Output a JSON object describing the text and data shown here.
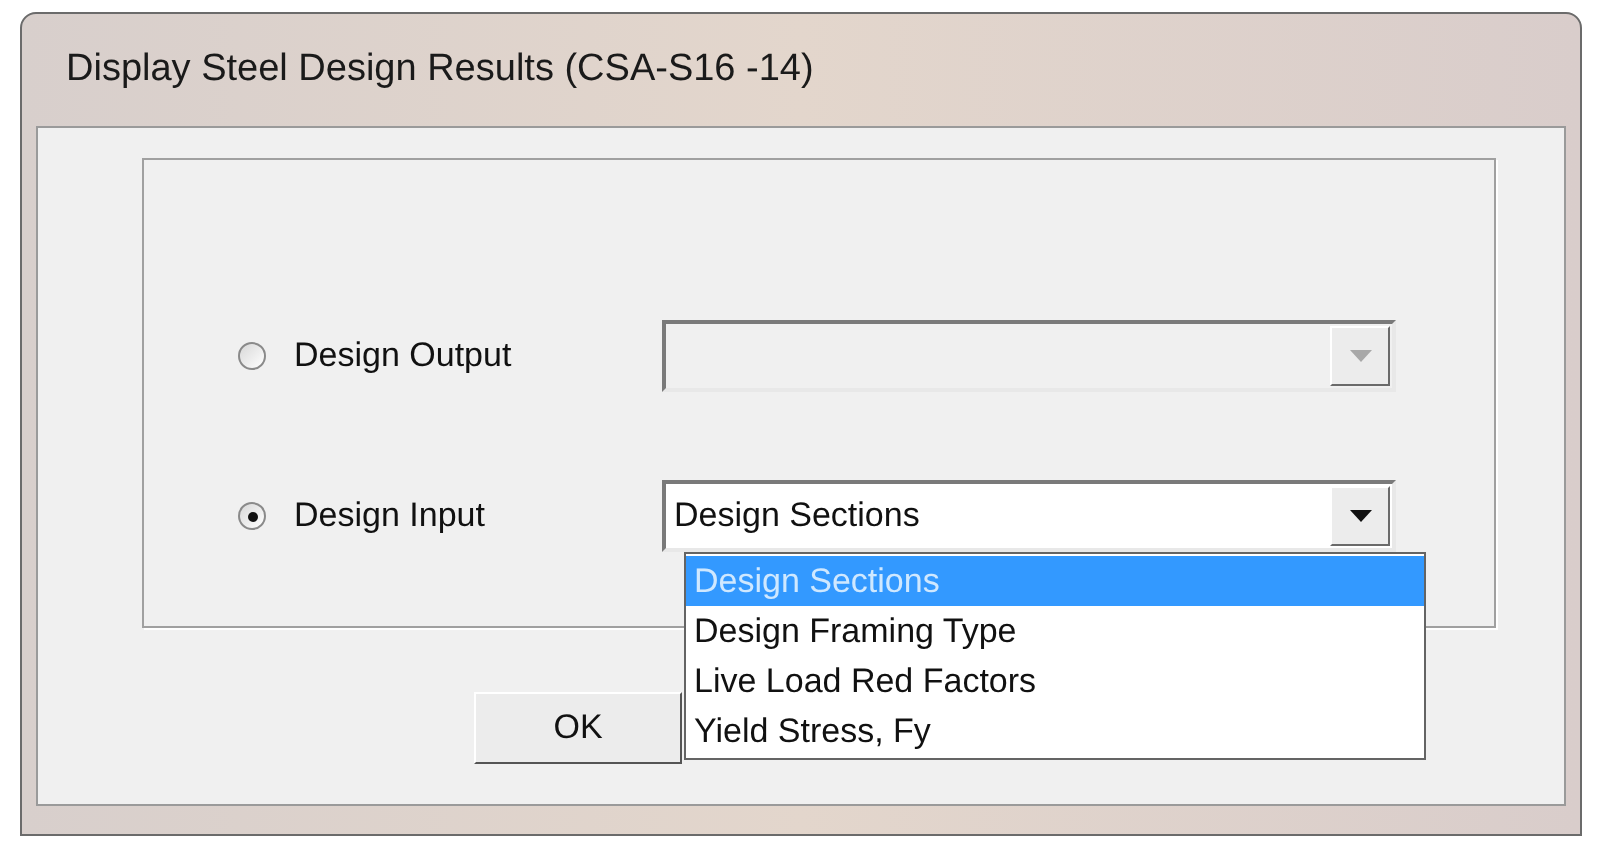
{
  "window": {
    "title": "Display Steel Design Results (CSA-S16 -14)"
  },
  "options": [
    {
      "label": "Design Output",
      "selected": false,
      "combo": {
        "disabled": true
      }
    },
    {
      "label": "Design Input",
      "selected": true,
      "combo": {
        "value": "Design Sections",
        "disabled": false
      }
    }
  ],
  "dropdown": {
    "items": [
      {
        "label": "Design Sections",
        "selected": true
      },
      {
        "label": "Design Framing Type",
        "selected": false
      },
      {
        "label": "Live Load Red Factors",
        "selected": false
      },
      {
        "label": "Yield Stress, Fy",
        "selected": false
      }
    ]
  },
  "buttons": [
    {
      "label": "OK"
    }
  ]
}
